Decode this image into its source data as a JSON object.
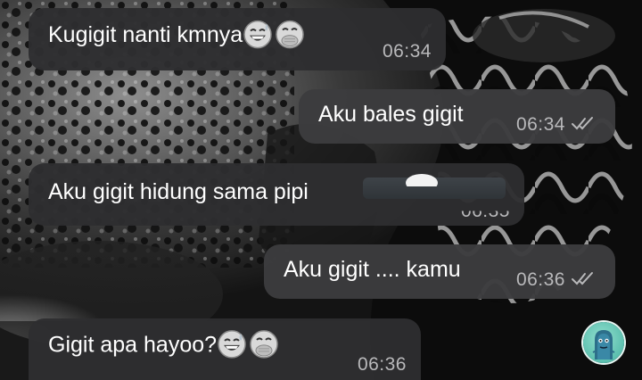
{
  "chat": {
    "messages": [
      {
        "text": "Kugigit nanti kmnya",
        "time": "06:34",
        "direction": "incoming",
        "emojis": [
          "grinning-sweat-emoji",
          "hand-over-mouth-emoji"
        ]
      },
      {
        "text": "Aku bales gigit",
        "time": "06:34",
        "direction": "outgoing",
        "status": "read"
      },
      {
        "text": "Aku gigit hidung sama pipi",
        "time": "06:35",
        "direction": "incoming",
        "emojis": [
          "obscured-emoji"
        ]
      },
      {
        "text": "Aku gigit .... kamu",
        "time": "06:36",
        "direction": "outgoing",
        "status": "read"
      },
      {
        "text": "Gigit apa hayoo?",
        "time": "06:36",
        "direction": "incoming",
        "emojis": [
          "grinning-sweat-emoji",
          "hand-over-mouth-emoji"
        ]
      }
    ]
  },
  "colors": {
    "incoming_bubble": "#2e2e30",
    "outgoing_bubble": "#3c3c3e",
    "timestamp": "#b9b9bb",
    "fab_accent": "#5bbfae"
  },
  "icons": {
    "read_receipt": "double-check-icon",
    "scroll_button": "mascot-avatar-icon"
  }
}
